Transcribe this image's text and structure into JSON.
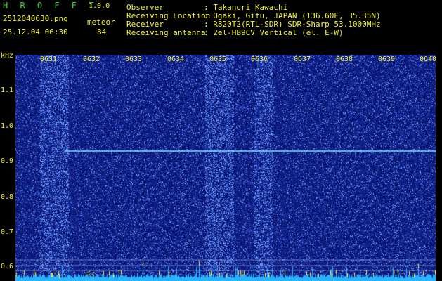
{
  "header": {
    "brand": "H R O F F T",
    "version": "1.0.0",
    "filename": "2512040630.png",
    "datetime": "25.12.04 06:30",
    "meteor_label": "meteor",
    "meteor_count": "84"
  },
  "info": [
    {
      "key": "Observer",
      "value": ": Takanori Kawachi"
    },
    {
      "key": "Receiving Location",
      "value": ": Ogaki, Gifu, JAPAN (136.60E, 35.35N)"
    },
    {
      "key": "Receiver",
      "value": ": R820T2(RTL-SDR) SDR-Sharp 53.1000MHz"
    },
    {
      "key": "Receiving antenna",
      "value": ": 2el-HB9CV Vertical (el. E-W)"
    }
  ],
  "axis": {
    "unit": "kHz",
    "y_ticks": [
      "1.1",
      "1.0",
      "0.9",
      "0.8",
      "0.7",
      "0.6"
    ],
    "x_ticks": [
      "0631",
      "0632",
      "0633",
      "0634",
      "0635",
      "0636",
      "0637",
      "0638",
      "0639",
      "0640"
    ]
  },
  "colors": {
    "background": "#000000",
    "waterfall_base": "#0a1670",
    "text_yellow": "#f0f040",
    "text_green": "#3fd13f",
    "carrier": "#7fe8ff",
    "bottom_trace": "#27b4ff"
  }
}
